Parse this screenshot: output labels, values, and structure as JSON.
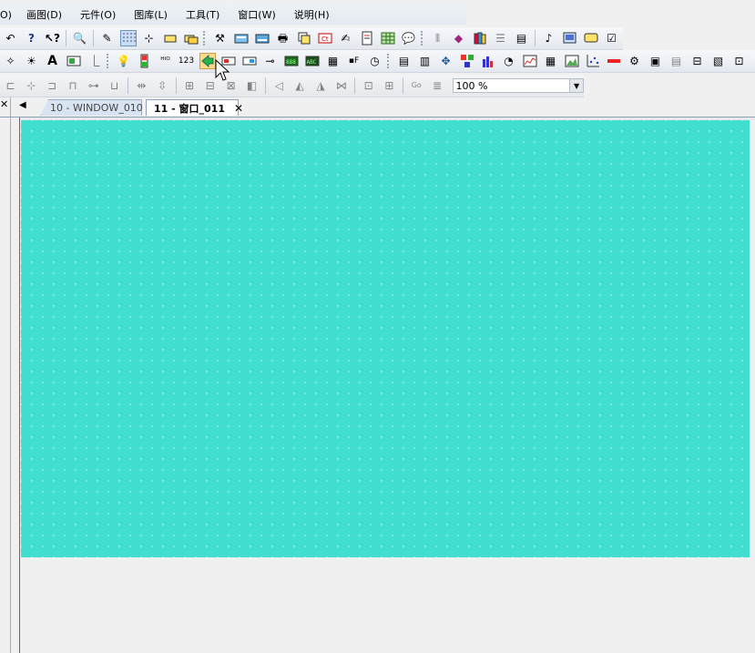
{
  "menu": {
    "items": [
      "O)",
      "画图(D)",
      "元件(O)",
      "图库(L)",
      "工具(T)",
      "窗口(W)",
      "说明(H)"
    ]
  },
  "toolbar3": {
    "zoom_value": "100 %"
  },
  "tabs": [
    {
      "label": "10 - WINDOW_010",
      "active": false
    },
    {
      "label": "11 - 窗口_011",
      "active": true,
      "close": "✕"
    }
  ],
  "canvas": {
    "color": "#40dfd0"
  },
  "icons": {
    "toolbar1": [
      "undo-icon",
      "help-icon",
      "context-help-icon",
      "find-icon",
      "pen-icon",
      "grid-icon",
      "snap-icon",
      "rect-icon",
      "layer-icon",
      "tools-icon",
      "keyboard-icon",
      "keyboard2-icon",
      "print-icon",
      "copy-window-icon",
      "wave-icon",
      "edit-icon",
      "report-icon",
      "table-icon",
      "comment-icon",
      "pipe-icon",
      "book-icon",
      "library-icon",
      "list-icon",
      "list2-icon",
      "music-icon",
      "video-icon",
      "message-icon",
      "checklist-icon"
    ],
    "toolbar2": [
      "polyline-icon",
      "sun-icon",
      "text-icon",
      "picture-icon",
      "line-icon",
      "lamp-icon",
      "bit-icon",
      "word-icon",
      "number-icon",
      "function-key-icon",
      "toggle-icon",
      "switch-icon",
      "slider-icon",
      "numeric-display-icon",
      "ascii-icon",
      "qr-icon",
      "date-icon",
      "clock-icon",
      "station-icon",
      "station2-icon",
      "move-icon",
      "cross-icon",
      "bar-chart-icon",
      "meter-icon",
      "trend-icon",
      "data-table-icon",
      "gallery-icon",
      "xy-plot-icon",
      "alarm-bar-icon",
      "event-icon",
      "record-icon",
      "recipe-icon",
      "backup-icon",
      "schedule-icon"
    ]
  }
}
